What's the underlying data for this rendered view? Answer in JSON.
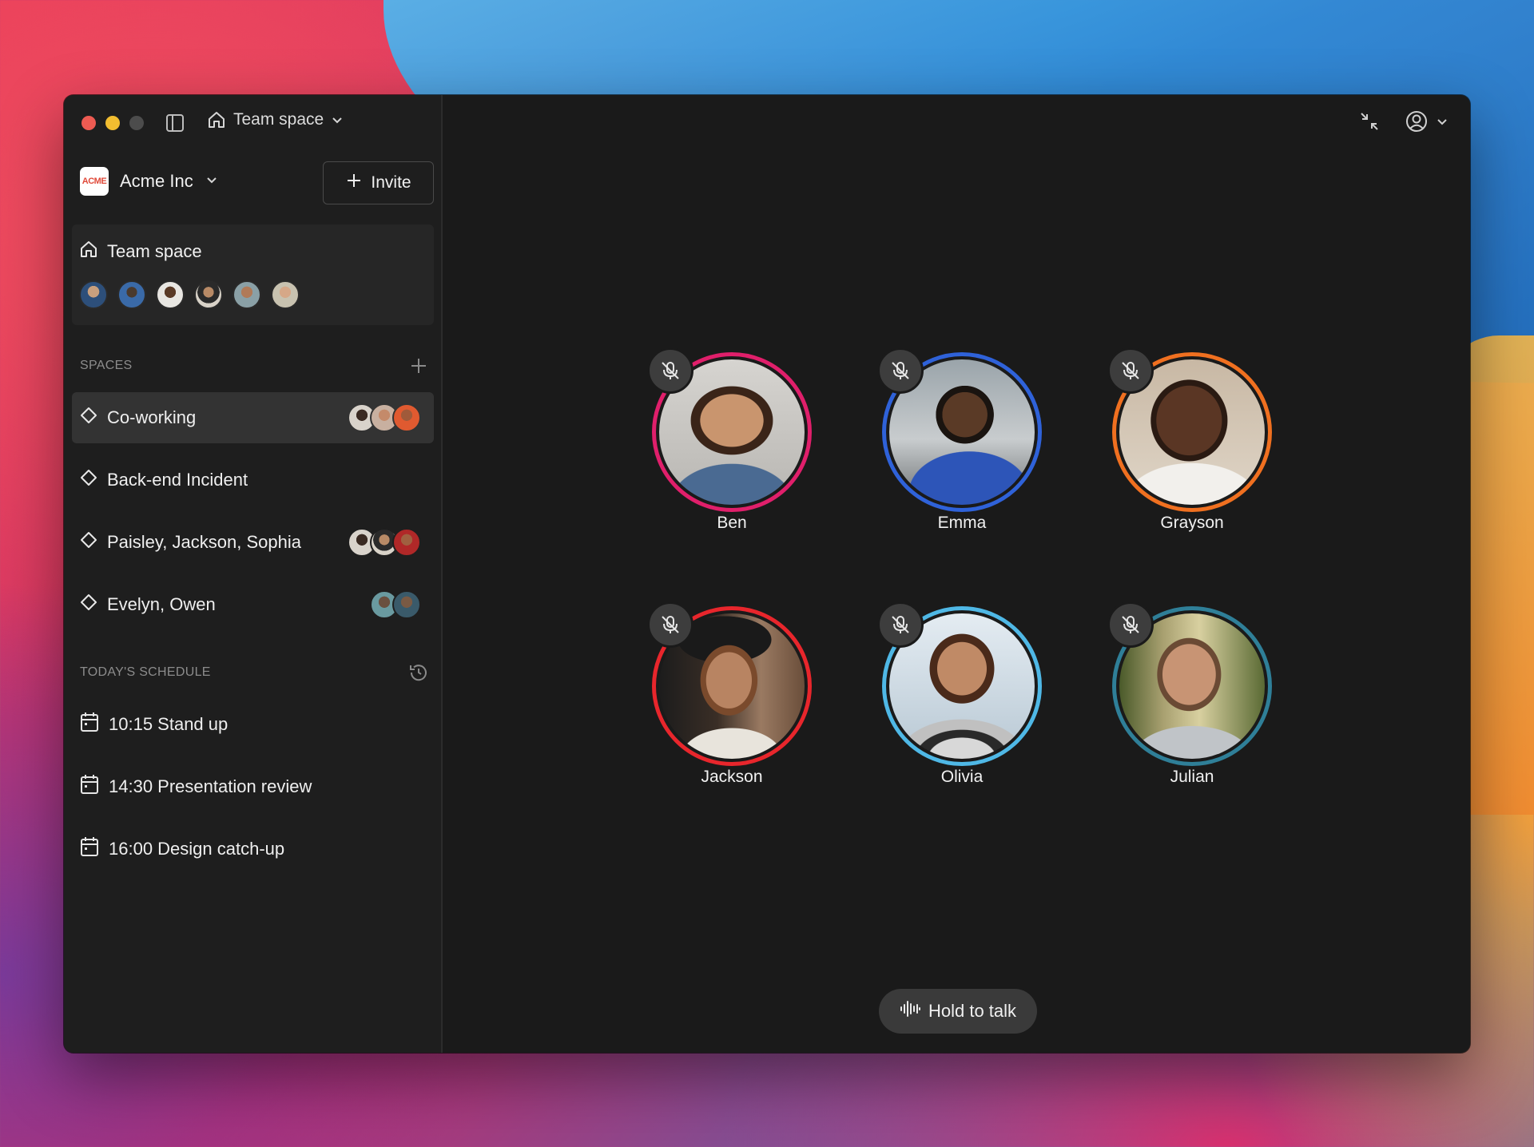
{
  "header": {
    "current_space": "Team space"
  },
  "org": {
    "name": "Acme Inc",
    "logo_text": "ACME",
    "invite_label": "Invite"
  },
  "team_card": {
    "title": "Team space"
  },
  "spaces": {
    "heading": "SPACES",
    "items": [
      {
        "label": "Co-working",
        "active": true
      },
      {
        "label": "Back-end Incident",
        "active": false
      },
      {
        "label": "Paisley, Jackson, Sophia",
        "active": false
      },
      {
        "label": "Evelyn, Owen",
        "active": false
      }
    ]
  },
  "schedule": {
    "heading": "TODAY'S SCHEDULE",
    "items": [
      {
        "label": "10:15 Stand up"
      },
      {
        "label": "14:30 Presentation review"
      },
      {
        "label": "16:00 Design catch-up"
      }
    ]
  },
  "participants": [
    {
      "name": "Ben",
      "ring_color": "#e01f6b"
    },
    {
      "name": "Emma",
      "ring_color": "#2f62d9"
    },
    {
      "name": "Grayson",
      "ring_color": "#f07020"
    },
    {
      "name": "Jackson",
      "ring_color": "#e8262c"
    },
    {
      "name": "Olivia",
      "ring_color": "#4fb8e6"
    },
    {
      "name": "Julian",
      "ring_color": "#2f7f98"
    }
  ],
  "talk": {
    "label": "Hold to talk"
  },
  "icons": {
    "mute": "microphone-off-icon",
    "home": "home-icon",
    "diamond": "diamond-icon",
    "calendar": "calendar-icon",
    "history": "history-icon",
    "add": "plus-icon",
    "collapse": "collapse-icon",
    "account": "user-circle-icon",
    "waveform": "waveform-icon"
  }
}
